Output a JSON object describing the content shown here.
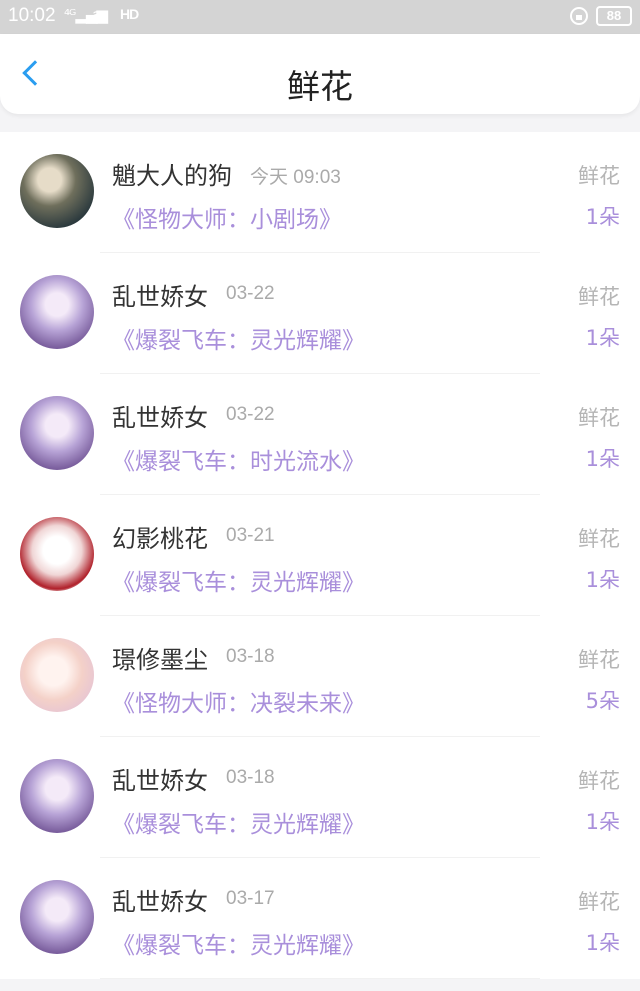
{
  "status": {
    "time": "10:02",
    "network": "4G",
    "hd": "HD",
    "battery": "88"
  },
  "header": {
    "title": "鲜花"
  },
  "items": [
    {
      "name": "魈大人的狗",
      "date": "今天 09:03",
      "book": "《怪物大师：小剧场》",
      "gift": "鲜花",
      "count": "1朵",
      "avatar": "dark"
    },
    {
      "name": "乱世娇女",
      "date": "03-22",
      "book": "《爆裂飞车：灵光辉耀》",
      "gift": "鲜花",
      "count": "1朵",
      "avatar": "purple"
    },
    {
      "name": "乱世娇女",
      "date": "03-22",
      "book": "《爆裂飞车：时光流水》",
      "gift": "鲜花",
      "count": "1朵",
      "avatar": "purple"
    },
    {
      "name": "幻影桃花",
      "date": "03-21",
      "book": "《爆裂飞车：灵光辉耀》",
      "gift": "鲜花",
      "count": "1朵",
      "avatar": "redhair"
    },
    {
      "name": "璟修墨尘",
      "date": "03-18",
      "book": "《怪物大师：决裂未来》",
      "gift": "鲜花",
      "count": "5朵",
      "avatar": "pink"
    },
    {
      "name": "乱世娇女",
      "date": "03-18",
      "book": "《爆裂飞车：灵光辉耀》",
      "gift": "鲜花",
      "count": "1朵",
      "avatar": "purple"
    },
    {
      "name": "乱世娇女",
      "date": "03-17",
      "book": "《爆裂飞车：灵光辉耀》",
      "gift": "鲜花",
      "count": "1朵",
      "avatar": "purple"
    }
  ]
}
